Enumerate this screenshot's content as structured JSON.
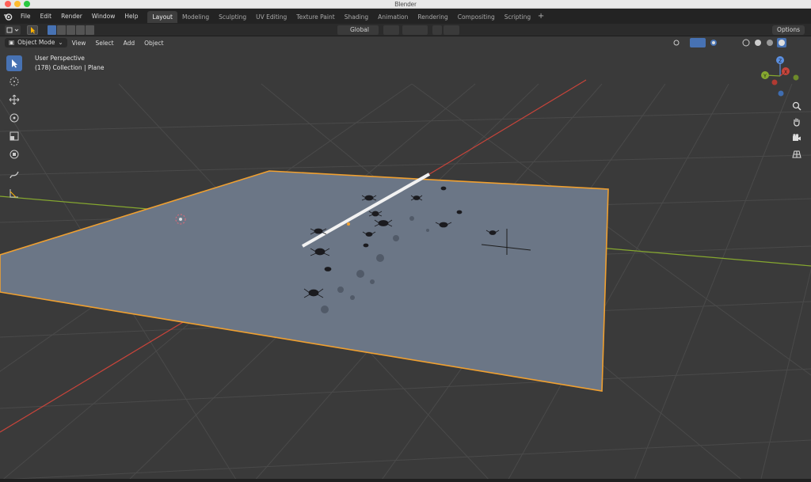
{
  "window": {
    "title": "Blender"
  },
  "menu": [
    "File",
    "Edit",
    "Render",
    "Window",
    "Help"
  ],
  "workspaces": [
    {
      "label": "Layout",
      "active": true
    },
    {
      "label": "Modeling"
    },
    {
      "label": "Sculpting"
    },
    {
      "label": "UV Editing"
    },
    {
      "label": "Texture Paint"
    },
    {
      "label": "Shading"
    },
    {
      "label": "Animation"
    },
    {
      "label": "Rendering"
    },
    {
      "label": "Compositing"
    },
    {
      "label": "Scripting"
    }
  ],
  "header": {
    "orientation": "Global",
    "options_label": "Options"
  },
  "viewport": {
    "mode": "Object Mode",
    "menus": [
      "View",
      "Select",
      "Add",
      "Object"
    ],
    "overlay_line1": "User Perspective",
    "overlay_line2": "(178) Collection | Plane"
  },
  "gizmo": {
    "x": "X",
    "y": "Y",
    "z": "Z"
  },
  "colors": {
    "accent": "#4772b3",
    "selection_outline": "#f0a030",
    "x_axis": "#c8443a",
    "y_axis": "#86a82f",
    "plane": "#6b7686"
  },
  "icons": [
    "blender-logo-icon",
    "select-box-icon",
    "cursor-icon",
    "move-icon",
    "rotate-icon",
    "scale-icon",
    "transform-icon",
    "annotate-icon",
    "measure-icon",
    "zoom-icon",
    "hand-icon",
    "camera-icon",
    "grid-icon"
  ]
}
